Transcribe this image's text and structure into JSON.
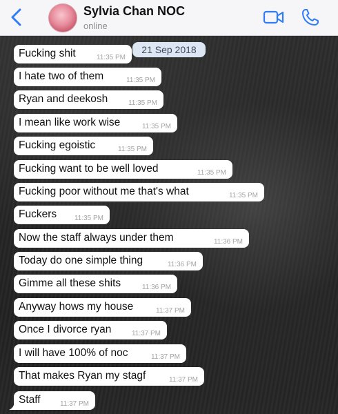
{
  "header": {
    "contact_name": "Sylvia Chan NOC",
    "status": "online",
    "accent_color": "#2f7cf6"
  },
  "chat": {
    "date_label": "21 Sep 2018",
    "messages": [
      {
        "text": "Fucking shit",
        "time": "11:35 PM"
      },
      {
        "text": "I hate two of them",
        "time": "11:35 PM"
      },
      {
        "text": "Ryan and deekosh",
        "time": "11:35 PM"
      },
      {
        "text": "I mean like work wise",
        "time": "11:35 PM"
      },
      {
        "text": "Fucking egoistic",
        "time": "11:35 PM"
      },
      {
        "text": "Fucking want to be well loved",
        "time": "11:35 PM"
      },
      {
        "text": "Fucking poor without me that's what",
        "time": "11:35 PM"
      },
      {
        "text": "Fuckers",
        "time": "11:35 PM"
      },
      {
        "text": "Now the staff always under them",
        "time": "11:36 PM"
      },
      {
        "text": "Today do one simple thing",
        "time": "11:36 PM"
      },
      {
        "text": "Gimme all these shits",
        "time": "11:36 PM"
      },
      {
        "text": "Anyway hows my house",
        "time": "11:37 PM"
      },
      {
        "text": "Once I divorce ryan",
        "time": "11:37 PM"
      },
      {
        "text": "I will have 100% of noc",
        "time": "11:37 PM"
      },
      {
        "text": "That makes Ryan my stagf",
        "time": "11:37 PM"
      },
      {
        "text": "Staff",
        "time": "11:37 PM"
      }
    ]
  }
}
